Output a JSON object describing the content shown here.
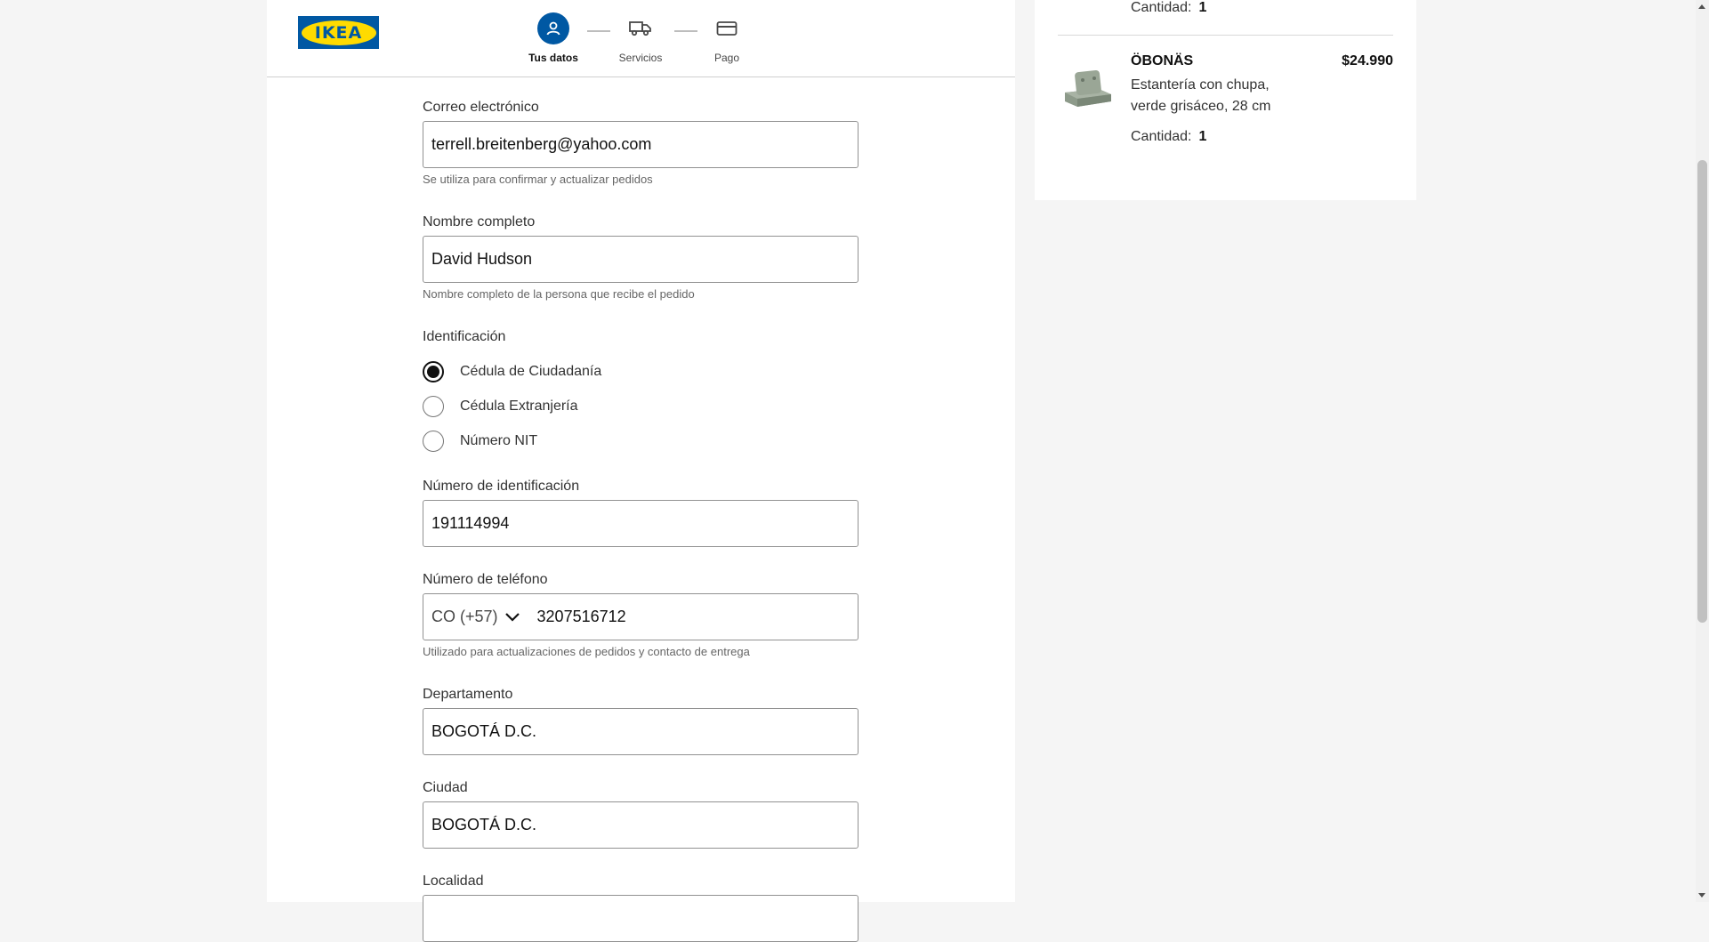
{
  "brand": {
    "logo_text": "IKEA",
    "logo_blue": "#0058a3",
    "logo_yellow": "#ffdb00"
  },
  "steps": [
    {
      "label": "Tus datos",
      "icon": "person-icon",
      "active": true
    },
    {
      "label": "Servicios",
      "icon": "truck-icon",
      "active": false
    },
    {
      "label": "Pago",
      "icon": "credit-card-icon",
      "active": false
    }
  ],
  "form": {
    "email": {
      "label": "Correo electrónico",
      "value": "terrell.breitenberg@yahoo.com",
      "helper": "Se utiliza para confirmar y actualizar pedidos"
    },
    "full_name": {
      "label": "Nombre completo",
      "value": "David Hudson",
      "helper": "Nombre completo de la persona que recibe el pedido"
    },
    "identification": {
      "label": "Identificación",
      "options": [
        "Cédula de Ciudadanía",
        "Cédula Extranjería",
        "Número NIT"
      ],
      "selected": "Cédula de Ciudadanía"
    },
    "id_number": {
      "label": "Número de identificación",
      "value": "191114994"
    },
    "phone": {
      "label": "Número de teléfono",
      "country_code": "CO (+57)",
      "value": "3207516712",
      "helper": "Utilizado para actualizaciones de pedidos y contacto de entrega"
    },
    "department": {
      "label": "Departamento",
      "value": "BOGOTÁ D.C."
    },
    "city": {
      "label": "Ciudad",
      "value": "BOGOTÁ D.C."
    },
    "locality": {
      "label": "Localidad",
      "value": ""
    }
  },
  "cart": {
    "quantity_label": "Cantidad:",
    "previous_item": {
      "quantity": "1"
    },
    "item": {
      "name": "ÖBONÄS",
      "description": "Estantería con chupa, verde grisáceo, 28 cm",
      "price": "$24.990",
      "quantity": "1"
    }
  },
  "colors": {
    "accent": "#0058a3",
    "product_green": "#8d9a8a"
  }
}
